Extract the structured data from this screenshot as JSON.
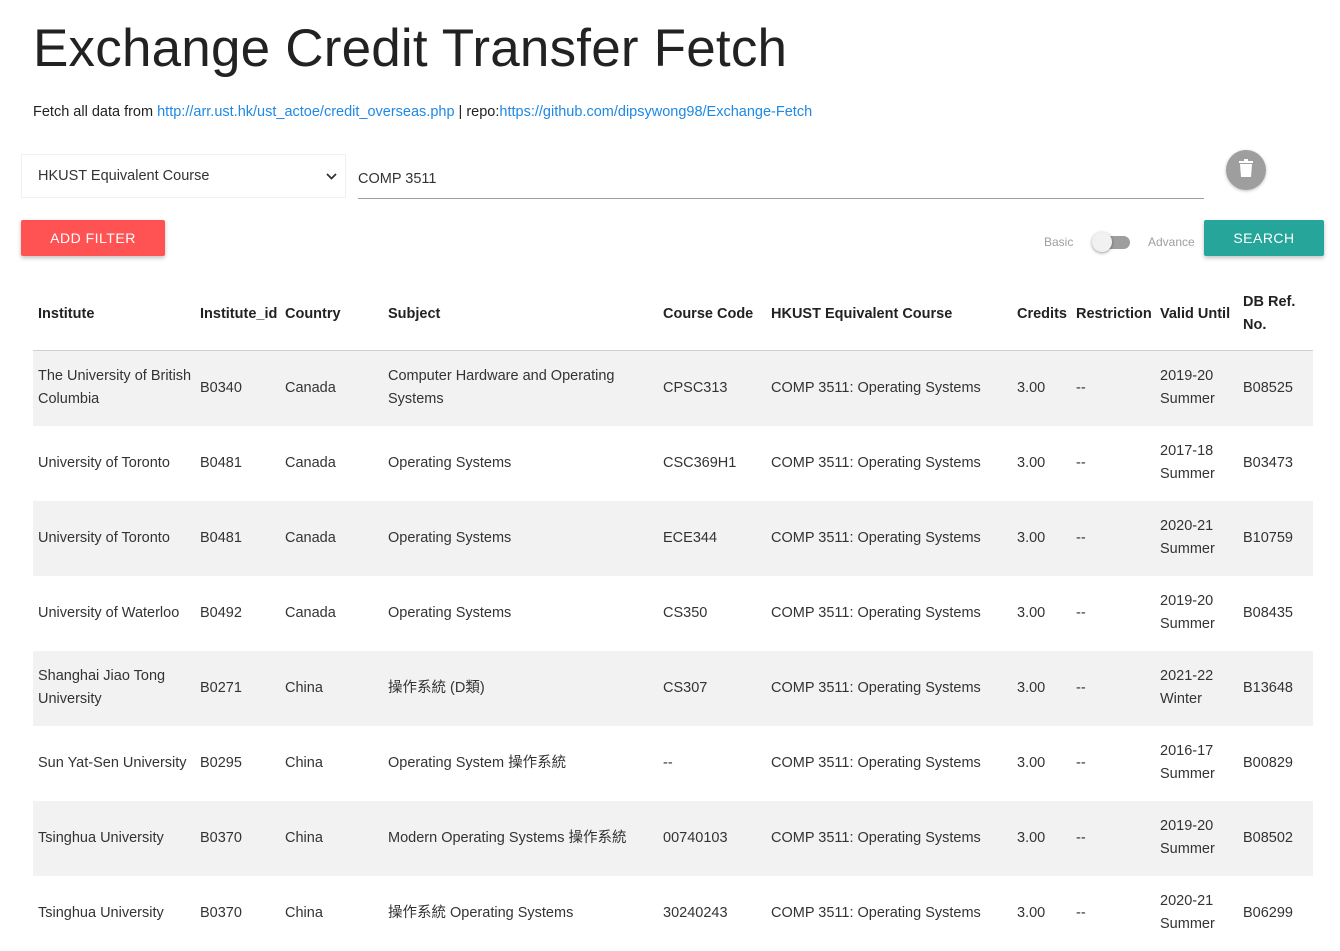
{
  "page": {
    "title": "Exchange Credit Transfer Fetch",
    "fetch_prefix": "Fetch all data from ",
    "fetch_link": "http://arr.ust.hk/ust_actoe/credit_overseas.php",
    "repo_prefix": " | repo:",
    "repo_link": "https://github.com/dipsywong98/Exchange-Fetch"
  },
  "filter": {
    "field_selected": "HKUST Equivalent Course",
    "query_value": "COMP 3511",
    "add_filter_label": "ADD FILTER",
    "search_label": "SEARCH",
    "mode_basic_label": "Basic",
    "mode_advance_label": "Advance",
    "mode_is_advance": false,
    "delete_icon": "trash-icon"
  },
  "colors": {
    "add_filter": "#ff5252",
    "search": "#26a69a",
    "link": "#1e88e5",
    "row_stripe": "#f2f2f2"
  },
  "table": {
    "headers": [
      "Institute",
      "Institute_id",
      "Country",
      "Subject",
      "Course Code",
      "HKUST Equivalent Course",
      "Credits",
      "Restriction",
      "Valid Until",
      "DB Ref. No."
    ],
    "rows": [
      [
        "The University of British Columbia",
        "B0340",
        "Canada",
        "Computer Hardware and Operating Systems",
        "CPSC313",
        "COMP 3511: Operating Systems",
        "3.00",
        "--",
        "2019-20 Summer",
        "B08525"
      ],
      [
        "University of Toronto",
        "B0481",
        "Canada",
        "Operating Systems",
        "CSC369H1",
        "COMP 3511: Operating Systems",
        "3.00",
        "--",
        "2017-18 Summer",
        "B03473"
      ],
      [
        "University of Toronto",
        "B0481",
        "Canada",
        "Operating Systems",
        "ECE344",
        "COMP 3511: Operating Systems",
        "3.00",
        "--",
        "2020-21 Summer",
        "B10759"
      ],
      [
        "University of Waterloo",
        "B0492",
        "Canada",
        "Operating Systems",
        "CS350",
        "COMP 3511: Operating Systems",
        "3.00",
        "--",
        "2019-20 Summer",
        "B08435"
      ],
      [
        "Shanghai Jiao Tong University",
        "B0271",
        "China",
        "操作系統 (D類)",
        "CS307",
        "COMP 3511: Operating Systems",
        "3.00",
        "--",
        "2021-22 Winter",
        "B13648"
      ],
      [
        "Sun Yat-Sen University",
        "B0295",
        "China",
        "Operating System 操作系統",
        "--",
        "COMP 3511: Operating Systems",
        "3.00",
        "--",
        "2016-17 Summer",
        "B00829"
      ],
      [
        "Tsinghua University",
        "B0370",
        "China",
        "Modern Operating Systems 操作系統",
        "00740103",
        "COMP 3511: Operating Systems",
        "3.00",
        "--",
        "2019-20 Summer",
        "B08502"
      ],
      [
        "Tsinghua University",
        "B0370",
        "China",
        "操作系統 Operating Systems",
        "30240243",
        "COMP 3511: Operating Systems",
        "3.00",
        "--",
        "2020-21 Summer",
        "B06299"
      ]
    ]
  }
}
